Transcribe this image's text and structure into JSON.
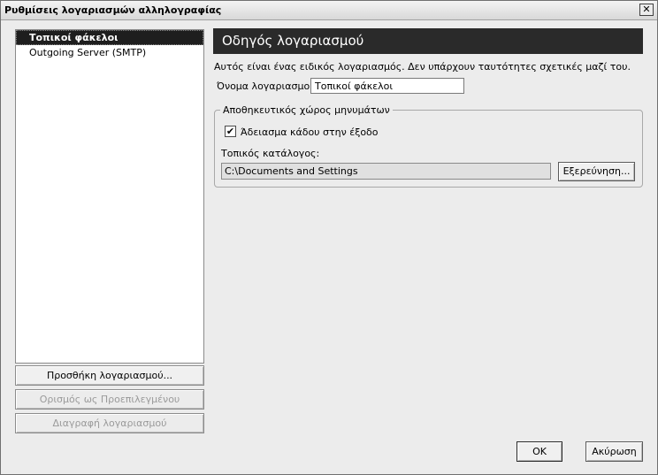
{
  "window": {
    "title": "Ρυθμίσεις λογαριασμών αλληλογραφίας",
    "close_glyph": "✕"
  },
  "accounts": {
    "items": [
      {
        "label": "Τοπικοί φάκελοι",
        "selected": true
      },
      {
        "label": "Outgoing Server (SMTP)",
        "selected": false
      }
    ]
  },
  "side_buttons": {
    "add": "Προσθήκη λογαριασμού...",
    "set_default": "Ορισμός ως Προεπιλεγμένου",
    "delete": "Διαγραφή λογαριασμού"
  },
  "panel": {
    "banner": "Οδηγός λογαριασμού",
    "description": "Αυτός είναι ένας ειδικός λογαριασμός. Δεν υπάρχουν ταυτότητες σχετικές μαζί του.",
    "account_name_label": "Όνομα λογαριασμού:",
    "account_name_value": "Τοπικοί φάκελοι",
    "storage_group_label": "Αποθηκευτικός χώρος μηνυμάτων",
    "empty_trash_label": "Άδειασμα κάδου στην έξοδο",
    "empty_trash_checked": true,
    "check_glyph": "✔",
    "local_dir_label": "Τοπικός κατάλογος:",
    "local_dir_value": "C:\\Documents and Settings",
    "browse_label": "Εξερεύνηση..."
  },
  "dialog_buttons": {
    "ok": "OK",
    "cancel": "Ακύρωση"
  }
}
